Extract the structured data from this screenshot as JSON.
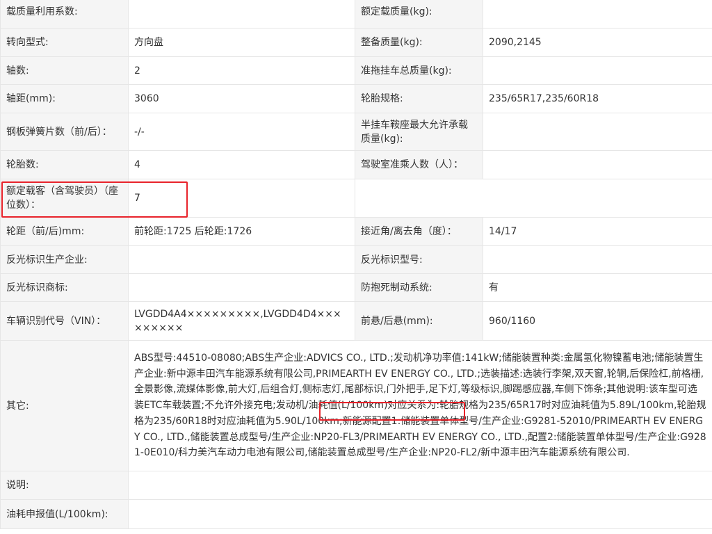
{
  "rows": {
    "r1": {
      "l1": "载质量利用系数:",
      "v1": "",
      "l2": "额定载质量(kg):",
      "v2": ""
    },
    "r2": {
      "l1": "转向型式:",
      "v1": "方向盘",
      "l2": "整备质量(kg):",
      "v2": "2090,2145"
    },
    "r3": {
      "l1": "轴数:",
      "v1": "2",
      "l2": "准拖挂车总质量(kg):",
      "v2": ""
    },
    "r4": {
      "l1": "轴距(mm):",
      "v1": "3060",
      "l2": "轮胎规格:",
      "v2": "235/65R17,235/60R18"
    },
    "r5": {
      "l1": "钢板弹簧片数（前/后）：",
      "v1": "-/-",
      "l2": "半挂车鞍座最大允许承载质量(kg):",
      "v2": ""
    },
    "r6": {
      "l1": "轮胎数:",
      "v1": "4",
      "l2": "驾驶室准乘人数（人）：",
      "v2": ""
    },
    "r7": {
      "l1": "额定载客（含驾驶员）（座位数）：",
      "v1": "7"
    },
    "r8": {
      "l1": "轮距（前/后)mm:",
      "v1": "前轮距:1725 后轮距:1726",
      "l2": "接近角/离去角（度）：",
      "v2": "14/17"
    },
    "r9": {
      "l1": "反光标识生产企业:",
      "v1": "",
      "l2": "反光标识型号:",
      "v2": ""
    },
    "r10": {
      "l1": "反光标识商标:",
      "v1": "",
      "l2": "防抱死制动系统:",
      "v2": "有"
    },
    "r11": {
      "l1": "车辆识别代号（VIN）：",
      "v1": "LVGDD4A4×××××××××,LVGDD4D4×××××××××",
      "l2": "前悬/后悬(mm):",
      "v2": "960/1160"
    },
    "r12": {
      "l1": "其它:",
      "v1": "ABS型号:44510-08080;ABS生产企业:ADVICS CO., LTD.;发动机净功率值:141kW;储能装置种类:金属氢化物镍蓄电池;储能装置生产企业:新中源丰田汽车能源系统有限公司,PRIMEARTH EV ENERGY CO., LTD.;选装描述:选装行李架,双天窗,轮辋,后保险杠,前格栅,全景影像,流媒体影像,前大灯,后组合灯,侧标志灯,尾部标识,门外把手,足下灯,等级标识,脚踢感应器,车侧下饰条;其他说明:该车型可选装ETC车载装置;不允许外接充电;发动机/油耗值(L/100km)对应关系为:轮胎规格为235/65R17时对应油耗值为5.89L/100km,轮胎规格为235/60R18时对应油耗值为5.90L/100km;新能源配置1:储能装置单体型号/生产企业:G9281-52010/PRIMEARTH EV ENERGY CO., LTD.,储能装置总成型号/生产企业:NP20-FL3/PRIMEARTH EV ENERGY CO., LTD.,配置2:储能装置单体型号/生产企业:G9281-0E010/科力美汽车动力电池有限公司,储能装置总成型号/生产企业:NP20-FL2/新中源丰田汽车能源系统有限公司."
    },
    "r13": {
      "l1": "说明:",
      "v1": ""
    },
    "r14": {
      "l1": "油耗申报值(L/100km):",
      "v1": ""
    }
  },
  "colors": {
    "highlight": "#e8232b",
    "label_bg": "#f5f5f5",
    "border": "#e6e6e6",
    "text": "#333333"
  }
}
